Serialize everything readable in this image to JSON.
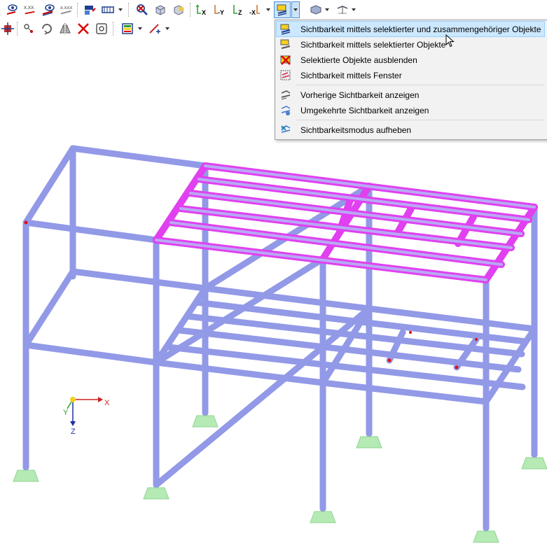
{
  "menu": {
    "items": [
      {
        "label": "Sichtbarkeit mittels selektierter und zusammengehöriger Objekte",
        "icon": "visibility-selected-related-icon",
        "highlighted": true
      },
      {
        "label": "Sichtbarkeit mittels selektierter Objekte",
        "icon": "visibility-selected-icon"
      },
      {
        "label": "Selektierte Objekte ausblenden",
        "icon": "hide-selected-icon"
      },
      {
        "label": "Sichtbarkeit mittels Fenster",
        "icon": "visibility-window-icon"
      },
      {
        "label": "Vorherige Sichtbarkeit anzeigen",
        "icon": "previous-visibility-icon"
      },
      {
        "label": "Umgekehrte Sichtbarkeit anzeigen",
        "icon": "inverted-visibility-icon"
      },
      {
        "label": "Sichtbarkeitsmodus aufheben",
        "icon": "reset-visibility-icon"
      }
    ]
  },
  "toolbar": {
    "row1": [
      "show-numbering-icon",
      "numbering-values-icon",
      "show-results-icon",
      "results-values-icon",
      "render-mode-icon",
      "section-view-icon",
      "zoom-reset-icon",
      "iso-view-icon",
      "view-3d-icon",
      "view-x-icon",
      "view-minus-y-icon",
      "view-z-icon",
      "view-minus-x-icon",
      "visibility-mode-icon",
      "display-options-icon",
      "coordinate-icon"
    ],
    "row1_labels": {
      "numbering_values": "X.XX",
      "results_values": "X.XXX",
      "view_x": "X",
      "view_minus_y": "-Y",
      "view_z": "Z",
      "view_minus_x": "-X"
    },
    "row2": [
      "move-icon",
      "select-node-icon",
      "rotate-icon",
      "mirror-icon",
      "delete-icon",
      "settings-icon",
      "color-scale-icon",
      "dimension-icon"
    ]
  },
  "axes": {
    "x": "X",
    "y": "Y",
    "z": "Z"
  },
  "colors": {
    "member": "#8f96e8",
    "selected": "#ff00ff",
    "support": "#a8e8a8",
    "menu_highlight": "#cce8ff"
  }
}
